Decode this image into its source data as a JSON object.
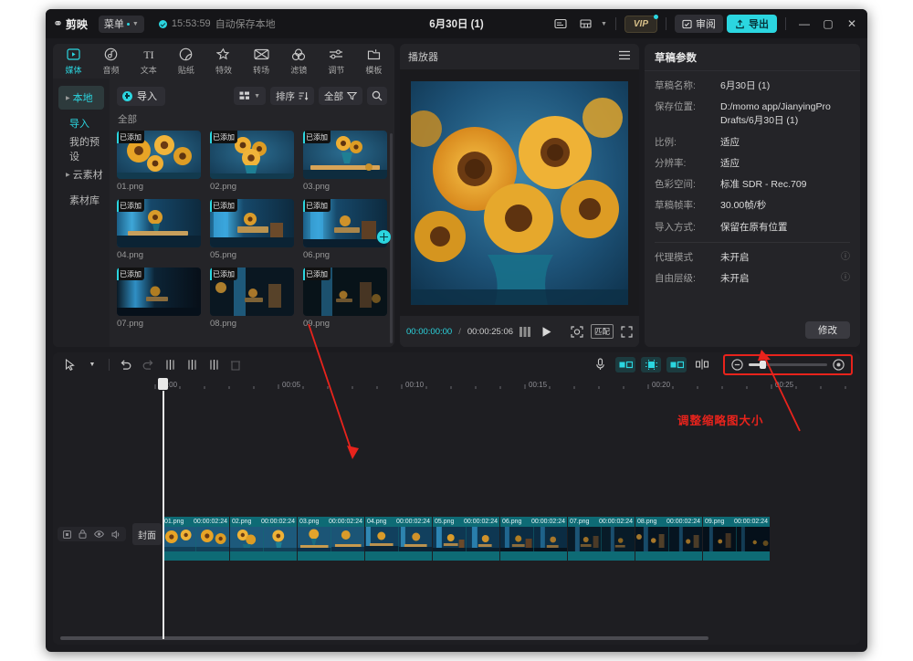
{
  "app": {
    "logo_text": "剪映",
    "menu_label": "菜单",
    "autosave_time": "15:53:59",
    "autosave_label": "自动保存本地",
    "document_title": "6月30日 (1)",
    "vip_label": "VIP",
    "review_label": "审阅",
    "export_label": "导出",
    "minimize": "—",
    "maximize": "▢",
    "close": "✕"
  },
  "tabs": [
    {
      "label": "媒体",
      "icon": "media-icon",
      "active": true
    },
    {
      "label": "音频",
      "icon": "audio-icon",
      "active": false
    },
    {
      "label": "文本",
      "icon": "text-icon",
      "active": false
    },
    {
      "label": "贴纸",
      "icon": "sticker-icon",
      "active": false
    },
    {
      "label": "特效",
      "icon": "effects-icon",
      "active": false
    },
    {
      "label": "转场",
      "icon": "transition-icon",
      "active": false
    },
    {
      "label": "滤镜",
      "icon": "filter-icon",
      "active": false
    },
    {
      "label": "调节",
      "icon": "adjust-icon",
      "active": false
    },
    {
      "label": "模板",
      "icon": "template-icon",
      "active": false
    }
  ],
  "sidebar": {
    "items": [
      {
        "label": "本地",
        "selected": true,
        "expandable": true
      },
      {
        "label": "导入",
        "selected": false,
        "highlight": true
      },
      {
        "label": "我的预设",
        "selected": false
      },
      {
        "label": "云素材",
        "selected": false,
        "expandable": true
      },
      {
        "label": "素材库",
        "selected": false
      }
    ]
  },
  "media": {
    "import_label": "导入",
    "view_icon": "grid-view-icon",
    "sort_label": "排序",
    "filter_label": "全部",
    "search_icon": "search-icon",
    "category_label": "全部",
    "added_badge": "已添加",
    "add_fab_icon": "plus-icon",
    "items": [
      {
        "name": "01.png",
        "badge": "已添加"
      },
      {
        "name": "02.png",
        "badge": "已添加"
      },
      {
        "name": "03.png",
        "badge": "已添加"
      },
      {
        "name": "04.png",
        "badge": "已添加"
      },
      {
        "name": "05.png",
        "badge": "已添加"
      },
      {
        "name": "06.png",
        "badge": "已添加"
      },
      {
        "name": "07.png",
        "badge": "已添加"
      },
      {
        "name": "08.png",
        "badge": "已添加"
      },
      {
        "name": "09.png",
        "badge": "已添加"
      }
    ]
  },
  "player": {
    "title": "播放器",
    "menu_icon": "hamburger-icon",
    "current_time": "00:00:00:00",
    "separator": "/",
    "total_time": "00:00:25:06",
    "play_icon": "play-icon",
    "frames_icon": "frames-icon",
    "focus_icon": "focus-icon",
    "ratio_label": "匹配",
    "fullscreen_icon": "fullscreen-icon"
  },
  "params": {
    "title": "草稿参数",
    "rows": [
      {
        "label": "草稿名称:",
        "value": "6月30日 (1)"
      },
      {
        "label": "保存位置:",
        "value": "D:/momo app/JianyingPro Drafts/6月30日 (1)"
      },
      {
        "label": "比例:",
        "value": "适应"
      },
      {
        "label": "分辨率:",
        "value": "适应"
      },
      {
        "label": "色彩空间:",
        "value": "标准 SDR - Rec.709"
      },
      {
        "label": "草稿帧率:",
        "value": "30.00帧/秒"
      },
      {
        "label": "导入方式:",
        "value": "保留在原有位置"
      }
    ],
    "extra_rows": [
      {
        "label": "代理模式",
        "value": "未开启",
        "help": "?"
      },
      {
        "label": "自由层级:",
        "value": "未开启",
        "help": "?"
      }
    ],
    "modify_label": "修改"
  },
  "timeline": {
    "tools": [
      {
        "icon": "select-arrow-icon"
      },
      {
        "icon": "chevron-down-icon"
      },
      {
        "icon": "undo-icon"
      },
      {
        "icon": "redo-icon"
      },
      {
        "icon": "split-icon"
      },
      {
        "icon": "trim-left-icon"
      },
      {
        "icon": "trim-right-icon"
      },
      {
        "icon": "delete-icon"
      }
    ],
    "right_tools": [
      {
        "icon": "microphone-icon"
      },
      {
        "icon": "mirror-icon"
      },
      {
        "icon": "crop-icon"
      },
      {
        "icon": "speed-icon"
      },
      {
        "icon": "keyframe-icon"
      }
    ],
    "zoom_out_icon": "zoom-out-icon",
    "zoom_in_icon": "zoom-in-icon",
    "ruler_ticks": [
      "00:00",
      "00:05",
      "00:10",
      "00:15",
      "00:20",
      "00:25"
    ],
    "track_header": {
      "cover_label": "封面",
      "icons": [
        "track-lock-icon",
        "track-mute-icon",
        "track-eye-icon",
        "track-volume-icon"
      ]
    },
    "clips": [
      {
        "name": "01.png",
        "duration": "00:00:02:24"
      },
      {
        "name": "02.png",
        "duration": "00:00:02:24"
      },
      {
        "name": "03.png",
        "duration": "00:00:02:24"
      },
      {
        "name": "04.png",
        "duration": "00:00:02:24"
      },
      {
        "name": "05.png",
        "duration": "00:00:02:24"
      },
      {
        "name": "06.png",
        "duration": "00:00:02:24"
      },
      {
        "name": "07.png",
        "duration": "00:00:02:24"
      },
      {
        "name": "08.png",
        "duration": "00:00:02:24"
      },
      {
        "name": "09.png",
        "duration": "00:00:02:24"
      }
    ]
  },
  "annotation": {
    "text": "调整缩略图大小",
    "color": "#e8231c"
  },
  "colors": {
    "accent": "#2bd6e0",
    "track": "#0e6b75",
    "annotation": "#e8231c",
    "panel": "#242428",
    "app_bg": "#1b1b1f"
  }
}
